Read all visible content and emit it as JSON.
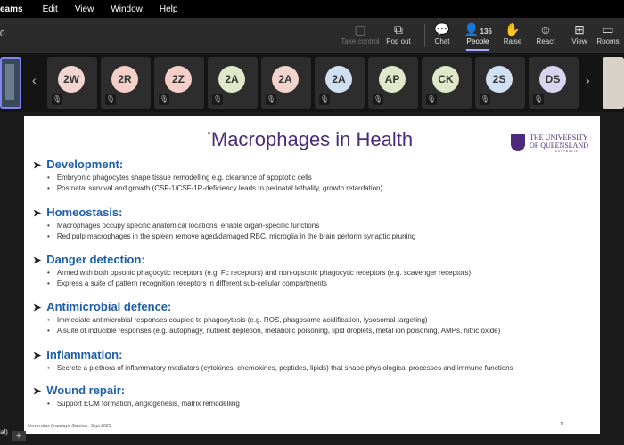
{
  "menubar": {
    "app": "eams",
    "items": [
      "Edit",
      "View",
      "Window",
      "Help"
    ]
  },
  "toolbar": {
    "timer": "0",
    "buttons": [
      {
        "label": "Take control",
        "icon": "take-control-icon",
        "disabled": true
      },
      {
        "label": "Pop out",
        "icon": "pop-out-icon"
      },
      {
        "label": "Chat",
        "icon": "chat-icon"
      },
      {
        "label": "People",
        "icon": "people-icon",
        "count": "136"
      },
      {
        "label": "Raise",
        "icon": "raise-hand-icon"
      },
      {
        "label": "React",
        "icon": "react-icon"
      },
      {
        "label": "View",
        "icon": "view-icon"
      },
      {
        "label": "Rooms",
        "icon": "rooms-icon"
      }
    ]
  },
  "participants": [
    {
      "initials": "2W",
      "color": "#f3d5d0"
    },
    {
      "initials": "2R",
      "color": "#f5cfc8"
    },
    {
      "initials": "2Z",
      "color": "#f5cfc8"
    },
    {
      "initials": "2A",
      "color": "#dfe8c8"
    },
    {
      "initials": "2A",
      "color": "#f2d4cd"
    },
    {
      "initials": "2A",
      "color": "#cfe0f2"
    },
    {
      "initials": "AP",
      "color": "#dfe8c8"
    },
    {
      "initials": "CK",
      "color": "#dfe8c8"
    },
    {
      "initials": "2S",
      "color": "#cfe0f2"
    },
    {
      "initials": "DS",
      "color": "#d8d4ee"
    }
  ],
  "slide": {
    "title": "Macrophages in Health",
    "logo": {
      "line1": "THE UNIVERSITY",
      "line2": "OF QUEENSLAND",
      "line3": "AUSTRALIA"
    },
    "sections": [
      {
        "heading": "Development:",
        "bullets": [
          "Embryonic phagocytes shape tissue remodelling e.g. clearance of apoptotic cells",
          "Postnatal survival and growth (CSF-1/CSF-1R-deficiency leads to perinatal lethality, growth retardation)"
        ]
      },
      {
        "heading": "Homeostasis:",
        "bullets": [
          "Macrophages occupy specific anatomical locations, enable organ-specific functions",
          "Red pulp macrophages in the spleen remove aged/damaged RBC, microglia in the brain perform synaptic pruning"
        ]
      },
      {
        "heading": "Danger detection:",
        "bullets": [
          "Armed with both opsonic phagocytic receptors (e.g. Fc receptors) and non-opsonic phagocytic receptors (e.g. scavenger receptors)",
          "Express a suite of pattern recognition receptors in different sub-cellular compartments"
        ]
      },
      {
        "heading": "Antimicrobial defence:",
        "bullets": [
          "Immediate antimicrobial responses coupled to phagocytosis (e.g. ROS, phagosome acidification, lysosomal targeting)",
          "A suite of inducible responses (e.g. autophagy, nutrient depletion, metabolic poisoning, lipid droplets, metal ion poisoning, AMPs, nitric oxide)"
        ]
      },
      {
        "heading": "Inflammation:",
        "bullets": [
          "Secrete a plethora of inflammatory mediators (cytokines, chemokines, peptides, lipids) that shape physiological processes and immune functions"
        ]
      },
      {
        "heading": "Wound repair:",
        "bullets": [
          "Support ECM formation, angiogenesis, matrix remodelling"
        ]
      }
    ],
    "footer": "Universitas Brawijaya Seminar: Sept 2025",
    "page_number": "11"
  },
  "bottom_left": "al)"
}
